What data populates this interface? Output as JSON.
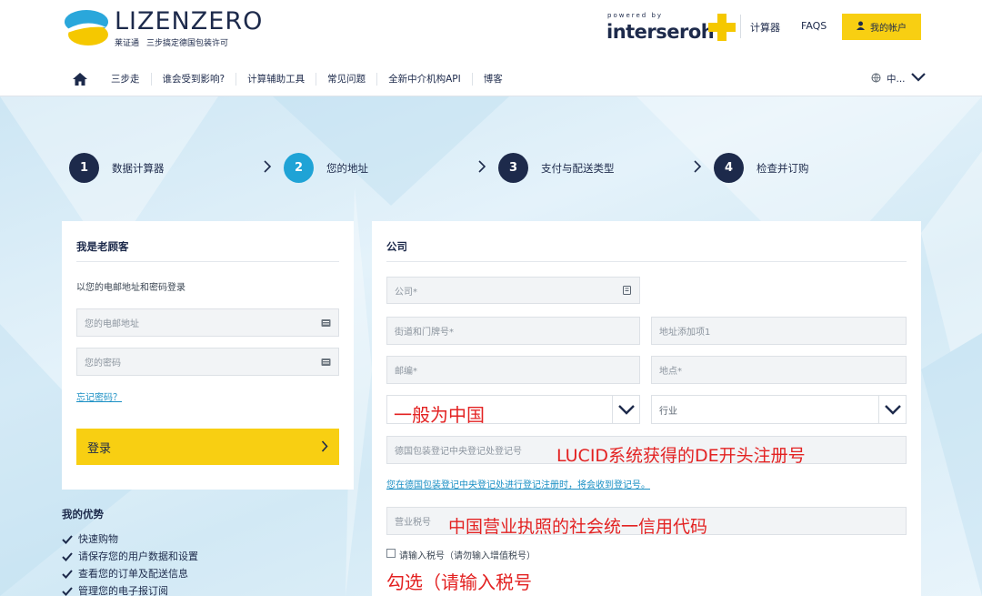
{
  "header": {
    "logo_name": "LIZENZERO",
    "logo_sub_1": "莱证通",
    "logo_sub_2": "三步搞定德国包装许可",
    "partner_powered": "powered by",
    "partner_name": "interseroh",
    "links": [
      "计算器",
      "FAQS"
    ],
    "account_button": "我的帐户"
  },
  "nav": {
    "items": [
      "三步走",
      "谁会受到影响?",
      "计算辅助工具",
      "常见问题",
      "全新中介机构API",
      "博客"
    ],
    "language": "中..."
  },
  "steps": [
    {
      "number": "1",
      "label": "数据计算器",
      "active": false
    },
    {
      "number": "2",
      "label": "您的地址",
      "active": true
    },
    {
      "number": "3",
      "label": "支付与配送类型",
      "active": false
    },
    {
      "number": "4",
      "label": "检查并订购",
      "active": false
    }
  ],
  "login_panel": {
    "title": "我是老顾客",
    "instruction": "以您的电邮地址和密码登录",
    "email_placeholder": "您的电邮地址",
    "password_placeholder": "您的密码",
    "forgot_link": "忘记密码？",
    "login_button": "登录"
  },
  "advantages": {
    "title": "我的优势",
    "items": [
      "快速购物",
      "请保存您的用户数据和设置",
      "查看您的订单及配送信息",
      "管理您的电子报订阅"
    ]
  },
  "address_panel": {
    "title": "公司",
    "company_placeholder": "公司*",
    "street_placeholder": "街道和门牌号*",
    "address_extra_placeholder": "地址添加项1",
    "zip_placeholder": "邮编*",
    "city_placeholder": "地点*",
    "country_value": "",
    "industry_value": "行业",
    "register_placeholder": "德国包装登记中央登记处登记号",
    "register_hint": "您在德国包装登记中央登记处进行登记注册时，将会收到登记号。",
    "tax_placeholder": "营业税号",
    "tax_checkbox_label": "请输入税号（请勿输入增值税号）"
  },
  "annotations": {
    "country": "一般为中国",
    "register": "LUCID系统获得的DE开头注册号",
    "tax": "中国营业执照的社会统一信用代码",
    "checkbox": "勾选（请输入税号"
  },
  "colors": {
    "navy": "#1d2a4b",
    "accent_blue": "#1fa3d6",
    "yellow": "#f8cf12",
    "annotation_red": "#e32222"
  }
}
